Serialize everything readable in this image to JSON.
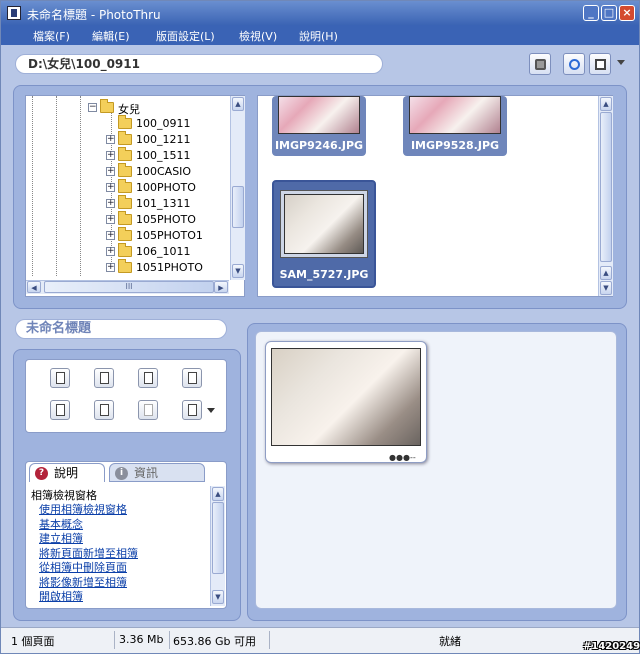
{
  "window": {
    "title": "未命名標題 - PhotoThru",
    "minimize_glyph": "_",
    "maximize_glyph": "□",
    "close_glyph": "×"
  },
  "menu": [
    {
      "label": "檔案(F)"
    },
    {
      "label": "編輯(E)"
    },
    {
      "label": "版面設定(L)"
    },
    {
      "label": "檢視(V)"
    },
    {
      "label": "說明(H)"
    }
  ],
  "path": {
    "value": "D:\\女兒\\100_0911"
  },
  "tree": {
    "root": "女兒",
    "folders": [
      "100_0911",
      "100_1211",
      "100_1511",
      "100CASIO",
      "100PHOTO",
      "101_1311",
      "105PHOTO",
      "105PHOTO1",
      "106_1011",
      "1051PHOTO"
    ],
    "hscroll_grip": "III"
  },
  "thumbnails": [
    {
      "caption": "IMGP9246.JPG"
    },
    {
      "caption": "IMGP9528.JPG"
    },
    {
      "caption": "SAM_5727.JPG"
    }
  ],
  "album": {
    "title": "未命名標題",
    "page_dots": "●●●--"
  },
  "toolbar_icons": [
    "new-page-icon",
    "open-album-icon",
    "save-icon",
    "copy-icon",
    "print-icon",
    "rotate-icon",
    "undo-icon",
    "layout-icon"
  ],
  "help": {
    "tabs": [
      {
        "label": "說明",
        "icon": "?"
      },
      {
        "label": "資訊",
        "icon": "i"
      }
    ],
    "heading": "相簿檢視窗格",
    "links": [
      "使用相簿檢視窗格",
      "基本概念",
      "建立相簿",
      "將新頁面新增至相簿",
      "從相簿中刪除頁面",
      "將影像新增至相簿",
      "開啟相簿"
    ]
  },
  "status": {
    "pages": "1 個頁面",
    "size": "3.36 Mb",
    "free": "653.86 Gb 可用",
    "state": "就緒"
  },
  "watermark": "#1420249",
  "colors": {
    "frame": "#b7c6e6",
    "panel": "#9fb3de",
    "titlebar": "#3b64b4",
    "link": "#0b3fa8"
  }
}
